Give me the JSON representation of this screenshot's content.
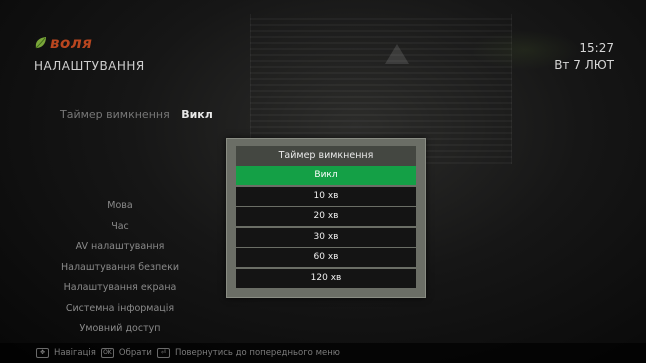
{
  "header": {
    "brand": "воля",
    "page_title": "НАЛАШТУВАННЯ",
    "time": "15:27",
    "date": "Вт 7 ЛЮТ"
  },
  "timer_setting": {
    "label": "Таймер вимкнення",
    "value": "Викл"
  },
  "menu": {
    "items": [
      {
        "label": "Мова"
      },
      {
        "label": "Час"
      },
      {
        "label": "AV налаштування"
      },
      {
        "label": "Налаштування безпеки"
      },
      {
        "label": "Налаштування екрана"
      },
      {
        "label": "Системна інформація"
      },
      {
        "label": "Умовний доступ"
      }
    ]
  },
  "dialog": {
    "title": "Таймер вимкнення",
    "selected_index": 0,
    "options": [
      {
        "label": "Викл"
      },
      {
        "label": "10 хв"
      },
      {
        "label": "20 хв"
      },
      {
        "label": "30 хв"
      },
      {
        "label": "60 хв"
      },
      {
        "label": "120 хв"
      }
    ]
  },
  "hints": {
    "navigate_icon": "dpad-icon",
    "navigate_label": "Навігація",
    "ok_icon": "ok-key-icon",
    "ok_label": "Обрати",
    "back_icon": "back-key-icon",
    "back_label": "Повернутись до попереднього меню"
  },
  "colors": {
    "brand": "#b9461f",
    "leaf": "#7aa63a",
    "selected": "#14a046"
  }
}
